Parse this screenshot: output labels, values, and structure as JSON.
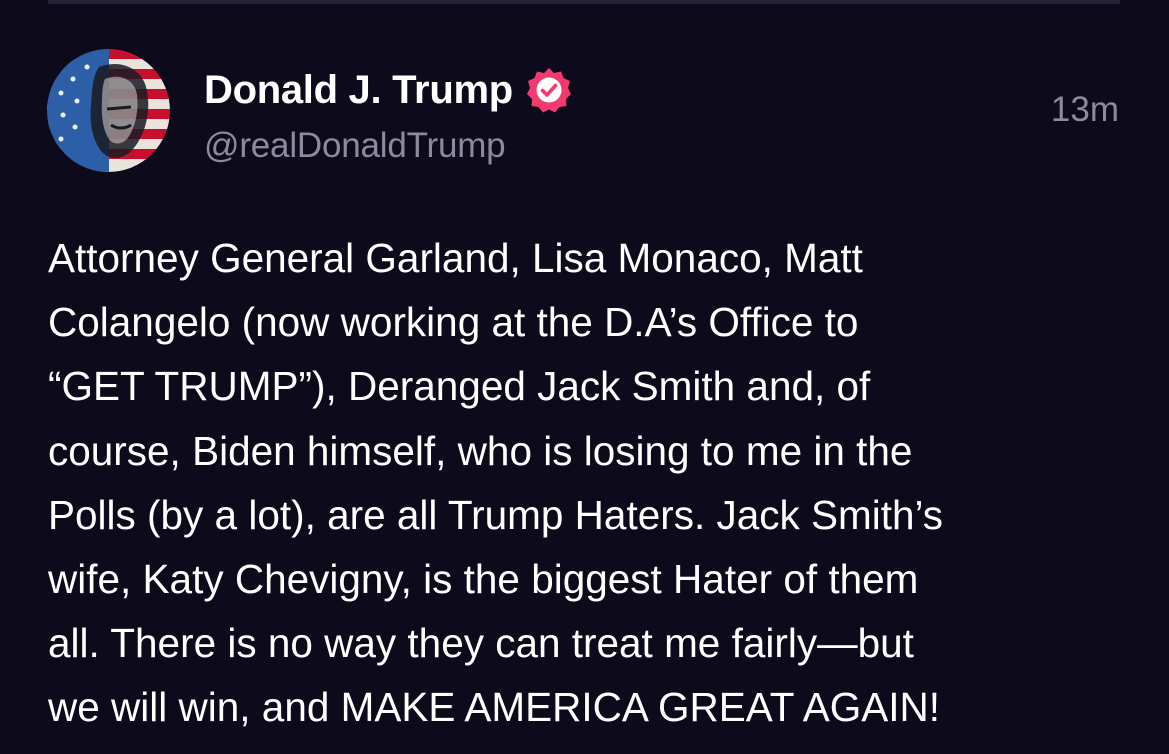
{
  "post": {
    "author": {
      "display_name": "Donald J. Trump",
      "handle": "@realDonaldTrump",
      "verified": true,
      "verified_color": "#f23a6e",
      "avatar_icon": "profile-photo-avatar"
    },
    "timestamp": "13m",
    "body_lines": [
      "Attorney General Garland, Lisa Monaco, Matt",
      "Colangelo (now working at the D.A’s Office to",
      "“GET TRUMP”), Deranged Jack Smith and, of",
      "course, Biden himself, who is losing to me in the",
      "Polls (by a lot), are all Trump Haters. Jack Smith’s",
      "wife, Katy Chevigny, is the biggest Hater of them",
      "all. There is no way they can treat me fairly—but",
      "we will win, and MAKE AMERICA GREAT AGAIN!"
    ]
  },
  "colors": {
    "background": "#0d0a1b",
    "text": "#ffffff",
    "secondary_text": "#8d8a9e",
    "divider": "#25233a"
  }
}
